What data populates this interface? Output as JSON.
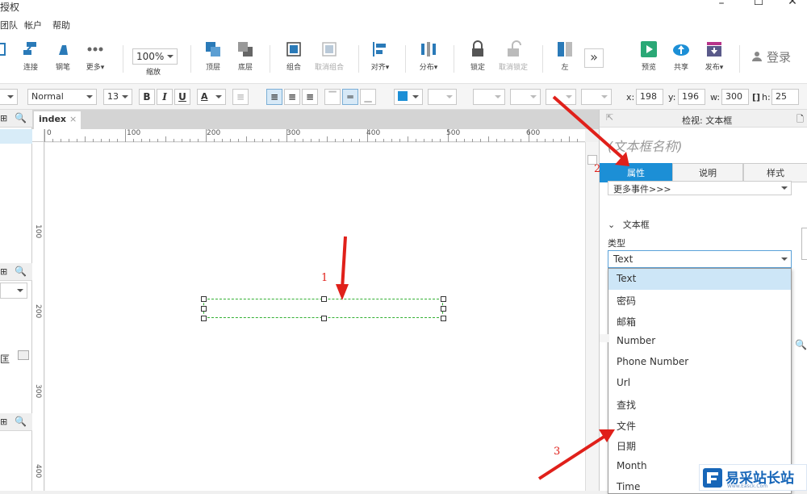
{
  "titlebar": {
    "title": "授权",
    "minimize": "–",
    "maximize": "☐",
    "close": "✕"
  },
  "menubar": {
    "items": [
      "团队",
      "帐户",
      "帮助"
    ]
  },
  "toolbar": {
    "buttons": [
      "连接",
      "钢笔",
      "更多▾",
      "缩放",
      "顶层",
      "底层",
      "组合",
      "取消组合",
      "对齐▾",
      "分布▾",
      "锁定",
      "取消锁定",
      "左",
      "预览",
      "共享",
      "发布▾"
    ],
    "zoom_value": "100%",
    "login_label": "登录"
  },
  "formatbar": {
    "style_value": "Normal",
    "font_size": "13",
    "bold": "B",
    "italic": "I",
    "underline": "U",
    "font_color": "A",
    "x_label": "x:",
    "x_value": "198",
    "y_label": "y:",
    "y_value": "196",
    "w_label": "w:",
    "w_value": "300",
    "h_label": "h:",
    "h_value": "25"
  },
  "canvas": {
    "tab_label": "index",
    "tab_close": "×",
    "ruler_top": [
      "0",
      "100",
      "200",
      "300",
      "400",
      "500",
      "600"
    ],
    "ruler_left": [
      "100",
      "200",
      "300",
      "400"
    ]
  },
  "inspector": {
    "title": "检视: 文本框",
    "widget_name_placeholder": "(文本框名称)",
    "tabs": [
      "属性",
      "说明",
      "样式"
    ],
    "more_events": "更多事件>>>",
    "section_title": "文本框",
    "type_label": "类型",
    "type_value": "Text",
    "type_options": [
      "Text",
      "密码",
      "邮箱",
      "Number",
      "Phone Number",
      "Url",
      "查找",
      "文件",
      "日期",
      "Month",
      "Time"
    ]
  },
  "annotations": [
    "1",
    "2",
    "3"
  ],
  "watermark": {
    "text": "易采站长站",
    "sub": "Www.Easck.Com"
  },
  "colors": {
    "accent": "#1c8fd6",
    "arrow": "#e0201a",
    "selection_border": "#33b033"
  }
}
